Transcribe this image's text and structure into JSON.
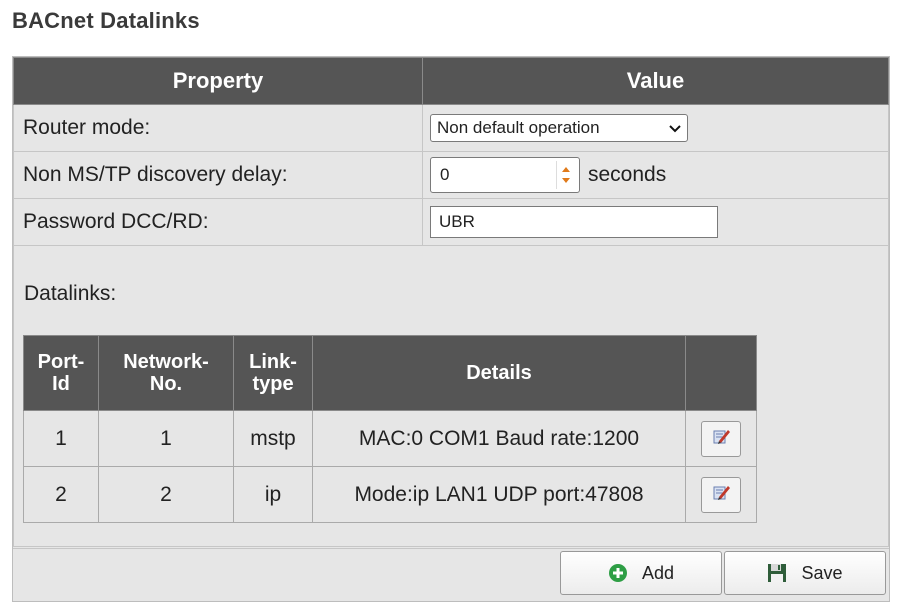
{
  "title": "BACnet Datalinks",
  "header": {
    "property": "Property",
    "value": "Value"
  },
  "router_mode": {
    "label": "Router mode:",
    "selected": "Non default operation"
  },
  "discovery_delay": {
    "label": "Non MS/TP discovery delay:",
    "value": "0",
    "units": "seconds"
  },
  "password": {
    "label": "Password DCC/RD:",
    "value": "UBR"
  },
  "datalinks": {
    "label": "Datalinks:",
    "columns": {
      "port_a": "Port-",
      "port_b": "Id",
      "network_a": "Network-",
      "network_b": "No.",
      "type_a": "Link-",
      "type_b": "type",
      "details": "Details"
    },
    "rows": [
      {
        "port_id": "1",
        "network_no": "1",
        "link_type": "mstp",
        "details": "MAC:0 COM1 Baud rate:1200"
      },
      {
        "port_id": "2",
        "network_no": "2",
        "link_type": "ip",
        "details": "Mode:ip LAN1 UDP port:47808"
      }
    ]
  },
  "buttons": {
    "add": "Add",
    "save": "Save"
  },
  "icons": {
    "edit": "edit-icon",
    "add": "plus-circle-icon",
    "save": "floppy-disk-icon",
    "select": "chevron-down-icon",
    "spinner": "spinner-arrows-icon"
  },
  "colors": {
    "header_bg": "#555555",
    "panel_bg": "#e6e6e6",
    "add_green": "#2e9e45",
    "spinner_orange": "#e07a1a"
  }
}
